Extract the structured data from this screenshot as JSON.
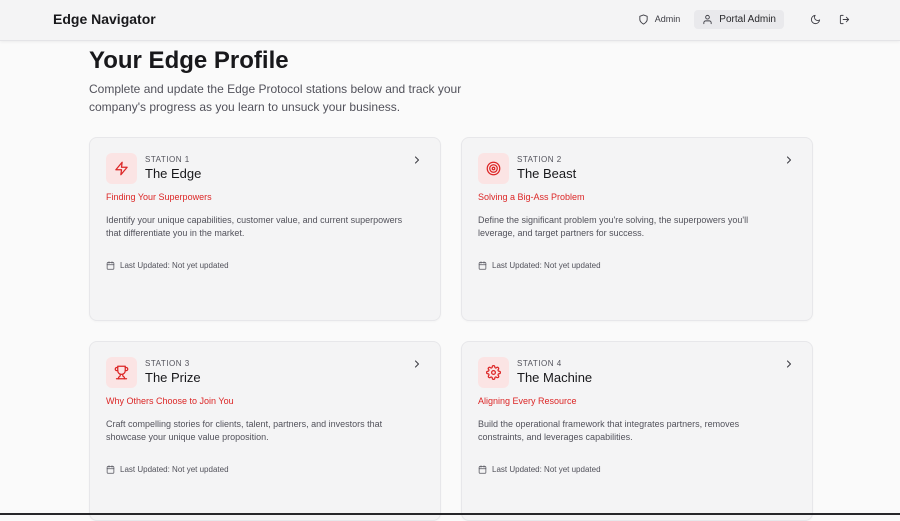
{
  "header": {
    "brand": "Edge Navigator",
    "admin_label": "Admin",
    "portal_label": "Portal Admin"
  },
  "page": {
    "title": "Your Edge Profile",
    "subtitle": "Complete and update the Edge Protocol stations below and track your company's progress as you learn to unsuck your business."
  },
  "stations": [
    {
      "station": "STATION 1",
      "name": "The Edge",
      "tagline": "Finding Your Superpowers",
      "description": "Identify your unique capabilities, customer value, and current superpowers that differentiate you in the market.",
      "updated": "Last Updated: Not yet updated",
      "icon": "zap-icon"
    },
    {
      "station": "STATION 2",
      "name": "The Beast",
      "tagline": "Solving a Big-Ass Problem",
      "description": "Define the significant problem you're solving, the superpowers you'll leverage, and target partners for success.",
      "updated": "Last Updated: Not yet updated",
      "icon": "target-icon"
    },
    {
      "station": "STATION 3",
      "name": "The Prize",
      "tagline": "Why Others Choose to Join You",
      "description": "Craft compelling stories for clients, talent, partners, and investors that showcase your unique value proposition.",
      "updated": "Last Updated: Not yet updated",
      "icon": "trophy-icon"
    },
    {
      "station": "STATION 4",
      "name": "The Machine",
      "tagline": "Aligning Every Resource",
      "description": "Build the operational framework that integrates partners, removes constraints, and leverages capabilities.",
      "updated": "Last Updated: Not yet updated",
      "icon": "gear-icon"
    }
  ],
  "colors": {
    "accent": "#dc2626",
    "icon_bg": "#fbe4e4",
    "card_bg": "#f4f4f5",
    "page_bg": "#fafafa"
  }
}
